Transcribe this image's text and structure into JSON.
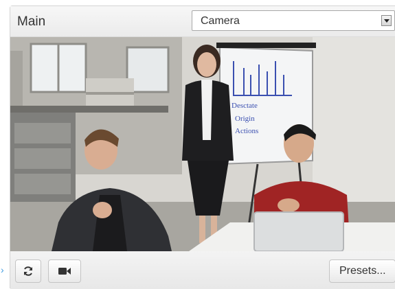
{
  "panel": {
    "title": "Main",
    "source_select": {
      "value": "Camera"
    }
  },
  "video": {
    "description_icon": "camera-feed",
    "colors": {
      "wall": "#dad8d4",
      "floor": "#a9a7a0",
      "shirt_red": "#a02424",
      "suit_dark": "#2c2c2e"
    },
    "whiteboard": {
      "lines": [
        "Desctate",
        "Origin",
        "Actions"
      ]
    }
  },
  "toolbar": {
    "refresh_icon": "refresh-icon",
    "camera_icon": "video-camera-icon",
    "presets_label": "Presets..."
  },
  "side_marker": "›"
}
